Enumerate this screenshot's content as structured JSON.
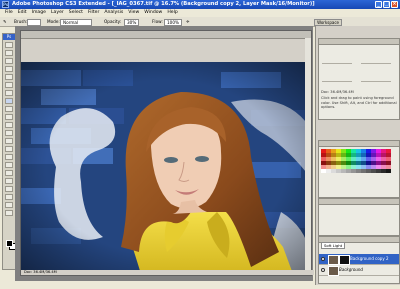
{
  "window": {
    "app_icon": "Ps",
    "title": "Adobe Photoshop CS3 Extended - [_IAG_0367.tif @ 16.7% (Background copy 2, Layer Mask/16/Monitor)]",
    "controls": [
      "minimize-icon",
      "maximize-icon",
      "close-icon"
    ]
  },
  "menu": [
    "File",
    "Edit",
    "Image",
    "Layer",
    "Select",
    "Filter",
    "Analysis",
    "View",
    "Window",
    "Help"
  ],
  "options": {
    "brush_label": "Brush:",
    "mode_label": "Mode:",
    "mode_value": "Normal",
    "opacity_label": "Opacity:",
    "opacity_value": "30%",
    "flow_label": "Flow:",
    "flow_value": "100%",
    "workspace_label": "Workspace"
  },
  "document": {
    "status": "Doc: 36.4M/36.4M"
  },
  "toolbox": {
    "header": "Ps"
  },
  "panels": {
    "info_doc": "Doc: 36.4M/36.4M",
    "info_hint": "Click and drag to paint using foreground color. Use Shift, Alt, and Ctrl for additional options.",
    "layers_blend": "Soft Light",
    "layers": [
      {
        "name": "Background copy 2",
        "selected": true,
        "has_mask": true
      },
      {
        "name": "Background",
        "selected": false,
        "has_mask": false
      }
    ]
  },
  "colors": {
    "titlebar": "#1f55c6",
    "selected_layer": "#3163c5"
  }
}
